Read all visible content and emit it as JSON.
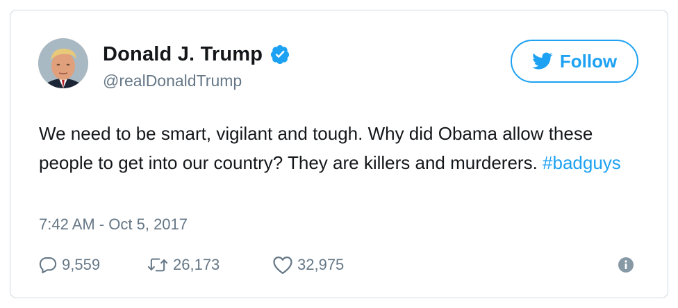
{
  "user": {
    "name": "Donald J. Trump",
    "handle": "@realDonaldTrump",
    "verified": true,
    "avatar_icon": "profile-photo"
  },
  "follow_button": {
    "label": "Follow",
    "icon": "bird-icon"
  },
  "tweet": {
    "text": "We need to be smart, vigilant and tough. Why did Obama allow these people to get into our country? They are killers and murderers. ",
    "hashtag": "#badguys",
    "timestamp": "7:42 AM - Oct 5, 2017"
  },
  "stats": {
    "replies": "9,559",
    "retweets": "26,173",
    "likes": "32,975"
  },
  "colors": {
    "accent": "#1da1f2",
    "text": "#14171a",
    "secondary": "#657786",
    "border": "#cfd9de"
  }
}
